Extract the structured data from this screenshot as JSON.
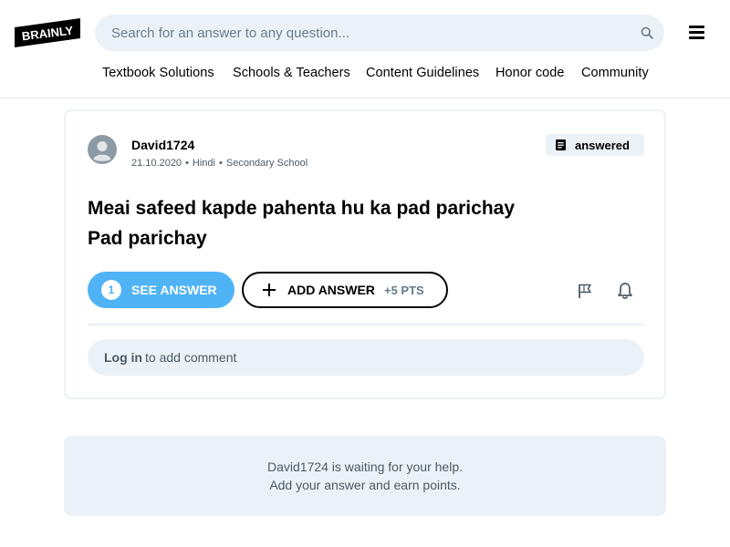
{
  "header": {
    "logo_text": "BRAINLY",
    "search": {
      "placeholder": "Search for an answer to any question..."
    },
    "nav": [
      "Textbook Solutions",
      "Schools & Teachers",
      "Content Guidelines",
      "Honor code",
      "Community"
    ]
  },
  "question": {
    "author": "David1724",
    "date": "21.10.2020",
    "subject": "Hindi",
    "level": "Secondary School",
    "status": "answered",
    "text_lines": [
      "Meai safeed kapde pahenta hu ka pad parichay",
      "Pad parichay"
    ],
    "see_answer": {
      "count": "1",
      "label": "SEE ANSWER"
    },
    "add_answer": {
      "label": "ADD ANSWER",
      "points": "+5 PTS"
    },
    "comment": {
      "login": "Log in",
      "rest": "to add comment"
    }
  },
  "waiting": {
    "line1": "David1724 is waiting for your help.",
    "line2": "Add your answer and earn points."
  },
  "colors": {
    "accent_blue": "#4fb3f6",
    "panel_gray": "#ebf2f7",
    "text_gray": "#4c5a66"
  }
}
